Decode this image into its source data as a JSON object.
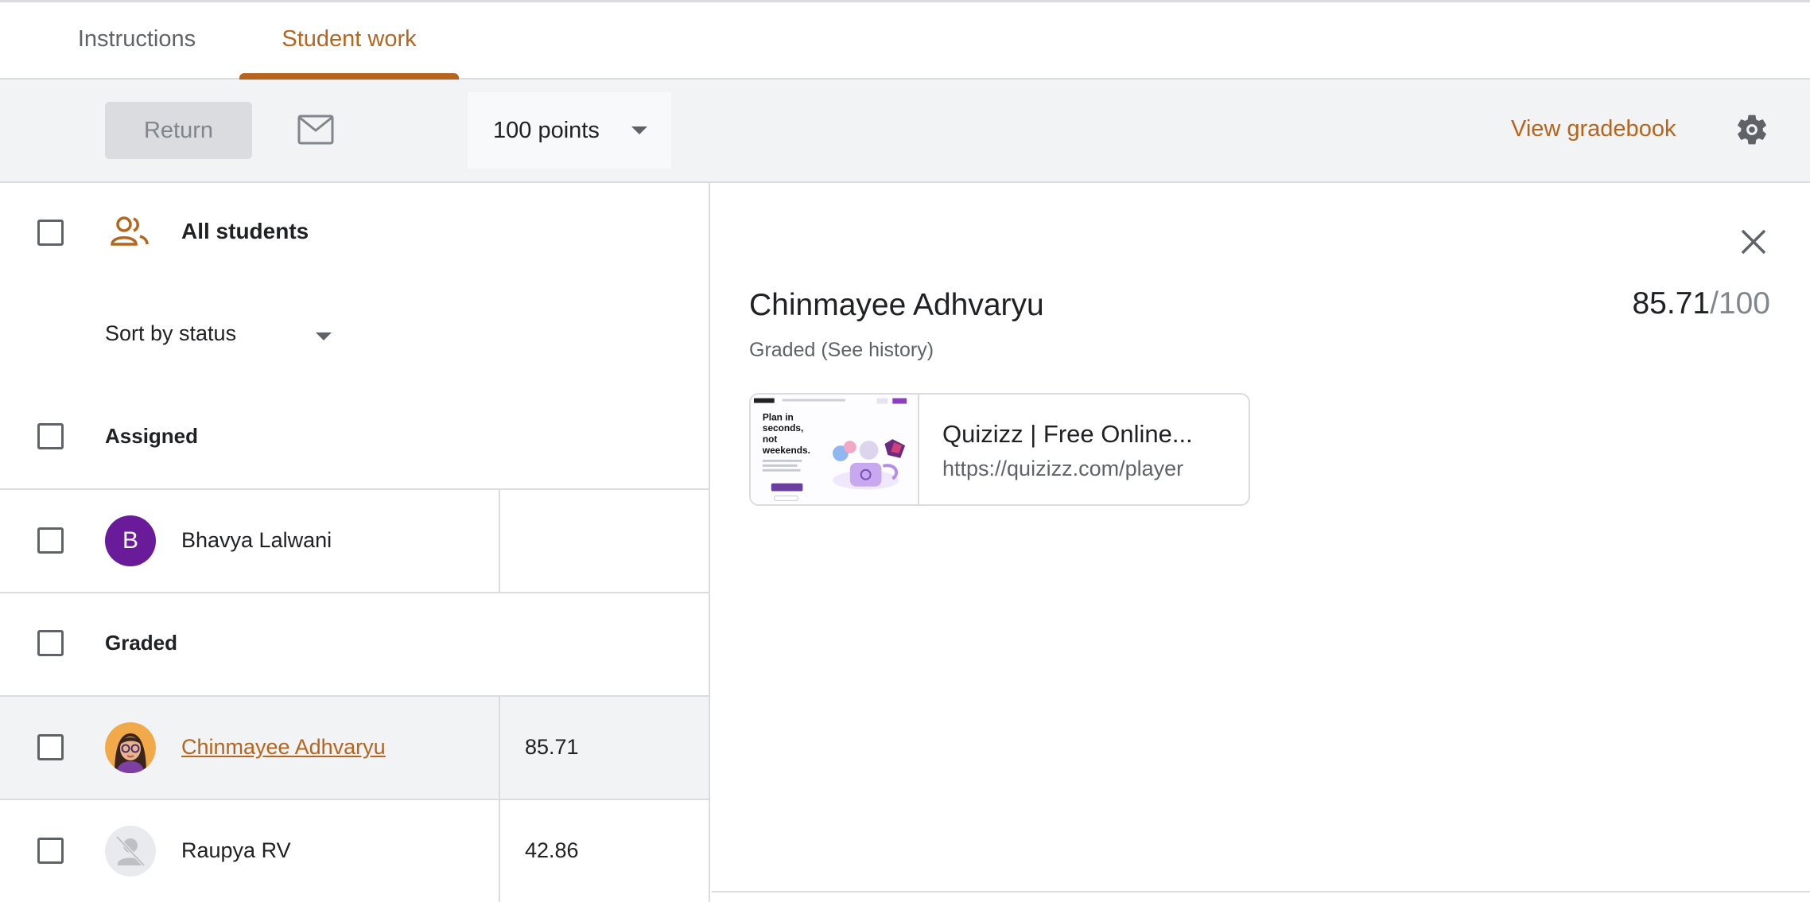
{
  "tabs": [
    {
      "label": "Instructions",
      "active": false
    },
    {
      "label": "Student work",
      "active": true
    }
  ],
  "toolbar": {
    "return_label": "Return",
    "points_label": "100 points",
    "gradebook_label": "View gradebook"
  },
  "list": {
    "all_students_label": "All students",
    "sort_label": "Sort by status",
    "groups": [
      {
        "label": "Assigned",
        "students": [
          {
            "name": "Bhavya Lalwani",
            "initial": "B",
            "score": ""
          }
        ]
      },
      {
        "label": "Graded",
        "students": [
          {
            "name": "Chinmayee Adhvaryu",
            "score": "85.71",
            "selected": true
          },
          {
            "name": "Raupya RV",
            "score": "42.86"
          }
        ]
      }
    ]
  },
  "detail": {
    "student_name": "Chinmayee Adhvaryu",
    "score": "85.71",
    "total": "/100",
    "status": "Graded (See history)",
    "attachment": {
      "title": "Quizizz | Free Online...",
      "url": "https://quizizz.com/player",
      "thumbnail_heading": "Plan in seconds, not weekends."
    }
  },
  "colors": {
    "accent": "#b5651d",
    "avatar_b": "#6a1b9a",
    "divider": "#dadce0",
    "toolbar_bg": "#f1f3f4"
  }
}
